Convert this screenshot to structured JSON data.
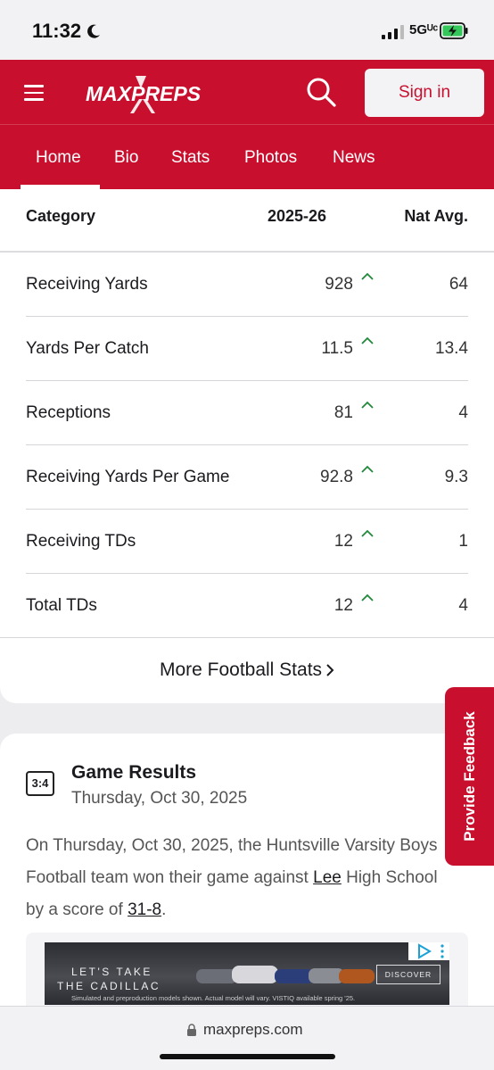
{
  "status_bar": {
    "time": "11:32",
    "network": "5Gᵁᶜ"
  },
  "header": {
    "logo_text": "MAXPREPS",
    "signin_label": "Sign in",
    "tabs": [
      {
        "label": "Home",
        "active": true
      },
      {
        "label": "Bio"
      },
      {
        "label": "Stats"
      },
      {
        "label": "Photos"
      },
      {
        "label": "News"
      }
    ],
    "brand_color": "#c8102e"
  },
  "stats_table": {
    "columns": [
      "Category",
      "2025-26",
      "Nat Avg."
    ],
    "rows": [
      {
        "category": "Receiving Yards",
        "value": "928",
        "nat_avg": "64",
        "trend": "up"
      },
      {
        "category": "Yards Per Catch",
        "value": "11.5",
        "nat_avg": "13.4",
        "trend": "up"
      },
      {
        "category": "Receptions",
        "value": "81",
        "nat_avg": "4",
        "trend": "up"
      },
      {
        "category": "Receiving Yards Per Game",
        "value": "92.8",
        "nat_avg": "9.3",
        "trend": "up"
      },
      {
        "category": "Receiving TDs",
        "value": "12",
        "nat_avg": "1",
        "trend": "up"
      },
      {
        "category": "Total TDs",
        "value": "12",
        "nat_avg": "4",
        "trend": "up"
      }
    ],
    "more_link": "More Football Stats"
  },
  "game_results": {
    "icon_text": "3:4",
    "title": "Game Results",
    "date": "Thursday, Oct 30, 2025",
    "line1": "On Thursday, Oct 30, 2025, the Huntsville Varsity Boys",
    "line2": "Football team won their game against ",
    "opponent": "Lee",
    "line2_end": " High School",
    "line3": "by a score of ",
    "score": "31-8",
    "line3_end": "."
  },
  "ad": {
    "line1": "LET'S TAKE",
    "line2": "THE CADILLAC",
    "fine_print": "Simulated and preproduction models shown. Actual model will vary. VISTIQ available spring '25.",
    "cta": "DISCOVER"
  },
  "feedback_tab": "Provide Feedback",
  "url": "maxpreps.com"
}
